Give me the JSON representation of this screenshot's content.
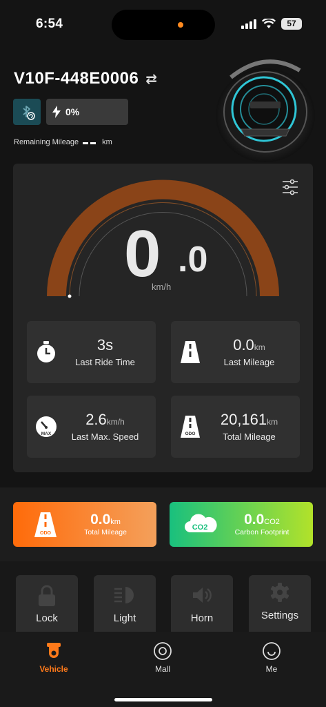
{
  "status_bar": {
    "time": "6:54",
    "battery": "57"
  },
  "header": {
    "device_name": "V10F-448E0006",
    "battery_percent": "0%",
    "remaining_label": "Remaining Mileage",
    "remaining_unit": "km"
  },
  "speedometer": {
    "integer": "0",
    "decimal": ".0",
    "unit": "km/h",
    "speed_fraction": 0
  },
  "stats": [
    {
      "value": "3s",
      "unit": "",
      "label": "Last Ride Time",
      "icon": "stopwatch-icon"
    },
    {
      "value": "0.0",
      "unit": "km",
      "label": "Last Mileage",
      "icon": "road-icon"
    },
    {
      "value": "2.6",
      "unit": "km/h",
      "label": "Last Max. Speed",
      "icon": "speedometer-max-icon",
      "icon_text": "MAX"
    },
    {
      "value": "20,161",
      "unit": "km",
      "label": "Total Mileage",
      "icon": "odometer-road-icon",
      "icon_text": "ODO"
    }
  ],
  "summary_cards": {
    "mileage": {
      "value": "0.0",
      "unit": "km",
      "label": "Total Mileage",
      "icon_text": "ODO",
      "color": "#ff6b0a"
    },
    "carbon": {
      "value": "0.0",
      "unit": "CO2",
      "label": "Carbon Footprint",
      "icon_text": "CO2",
      "color": "#19c07e"
    }
  },
  "controls": [
    {
      "label": "Lock",
      "icon": "lock-icon"
    },
    {
      "label": "Light",
      "icon": "headlight-icon"
    },
    {
      "label": "Horn",
      "icon": "horn-icon"
    },
    {
      "label": "Settings",
      "icon": "gear-icon"
    }
  ],
  "tabs": [
    {
      "label": "Vehicle",
      "icon": "vehicle-icon",
      "active": true
    },
    {
      "label": "Mall",
      "icon": "mall-icon",
      "active": false
    },
    {
      "label": "Me",
      "icon": "me-icon",
      "active": false
    }
  ],
  "colors": {
    "accent": "#ff7a1a",
    "gauge": "#8a4418",
    "bluetooth_bg": "#1b4b55"
  }
}
